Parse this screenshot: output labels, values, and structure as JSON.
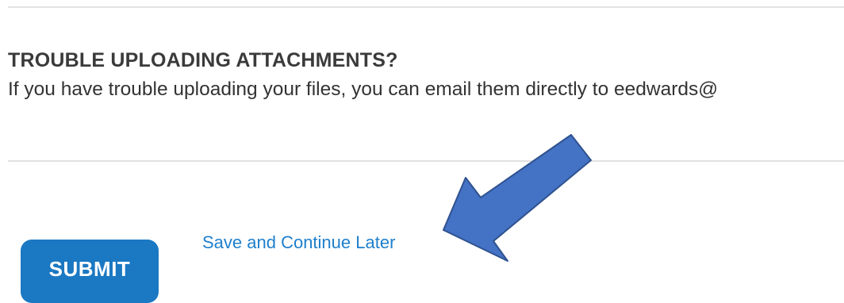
{
  "section": {
    "heading": "TROUBLE UPLOADING ATTACHMENTS?",
    "note": "If you have trouble uploading your files, you can email them directly to eedwards@"
  },
  "actions": {
    "submit_label": "SUBMIT",
    "save_link_label": "Save and Continue Later"
  },
  "annotation": {
    "arrow_icon": "arrow-pointing-left-down-icon",
    "arrow_fill": "#4472c4",
    "arrow_stroke": "#2f528f"
  },
  "colors": {
    "button": "#1b78c2",
    "link": "#1f7fcc",
    "heading": "#3a3a3a",
    "divider": "#e2e2e2"
  }
}
